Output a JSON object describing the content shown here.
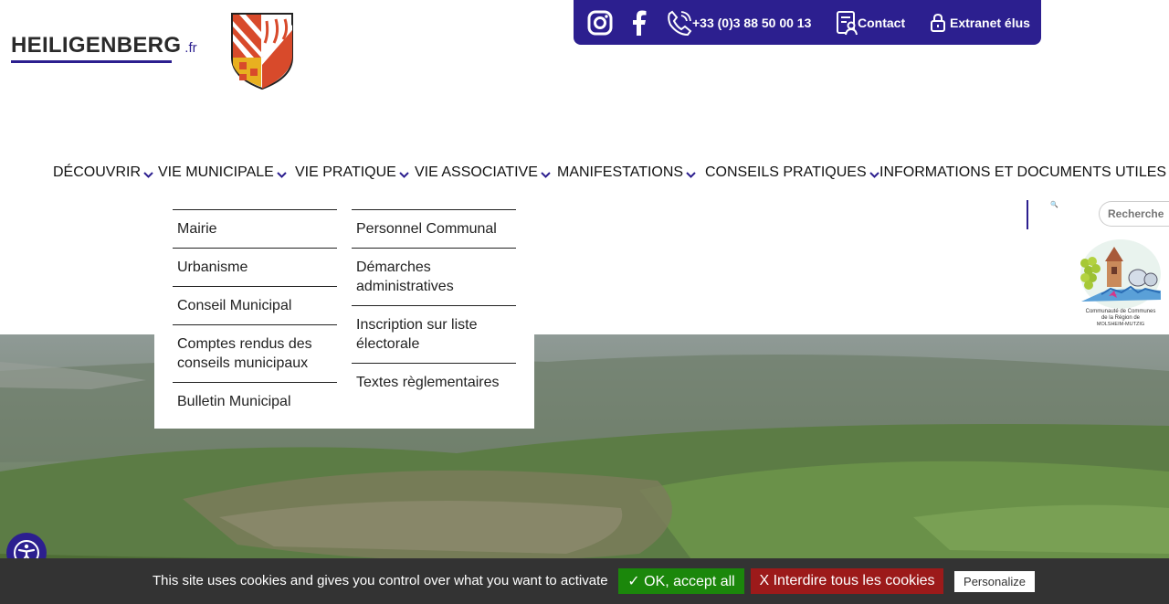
{
  "site": {
    "logo_text": "HEILIGENBERG",
    "logo_tld": ".fr"
  },
  "topbar": {
    "phone": "+33 (0)3 88 50 00 13",
    "contact": "Contact",
    "extranet": "Extranet élus",
    "color": "#2c1f8f"
  },
  "nav": {
    "items": [
      {
        "label": "DÉCOUVRIR"
      },
      {
        "label": "VIE MUNICIPALE"
      },
      {
        "label": "VIE PRATIQUE"
      },
      {
        "label": "VIE ASSOCIATIVE"
      },
      {
        "label": "MANIFESTATIONS"
      },
      {
        "label": "CONSEILS PRATIQUES"
      },
      {
        "label": "INFORMATIONS ET DOCUMENTS UTILES"
      }
    ]
  },
  "dropdown": {
    "left": [
      "Mairie",
      "Urbanisme",
      "Conseil Municipal",
      "Comptes rendus des conseils municipaux",
      "Bulletin Municipal"
    ],
    "right": [
      "Personnel Communal",
      "Démarches administratives",
      "Inscription sur liste électorale",
      "Textes règlementaires"
    ]
  },
  "search": {
    "placeholder": "Recherche"
  },
  "cookies": {
    "message": "This site uses cookies and gives you control over what you want to activate",
    "accept": "✓ OK, accept all",
    "deny": "X Interdire tous les cookies",
    "personalize": "Personalize",
    "accept_color": "#1b870b",
    "deny_color": "#9c1a1a"
  },
  "icons": [
    "instagram-icon",
    "facebook-icon",
    "phone-icon",
    "contact-icon",
    "lock-icon",
    "search-icon",
    "accessibility-icon",
    "chevron-down-icon"
  ]
}
